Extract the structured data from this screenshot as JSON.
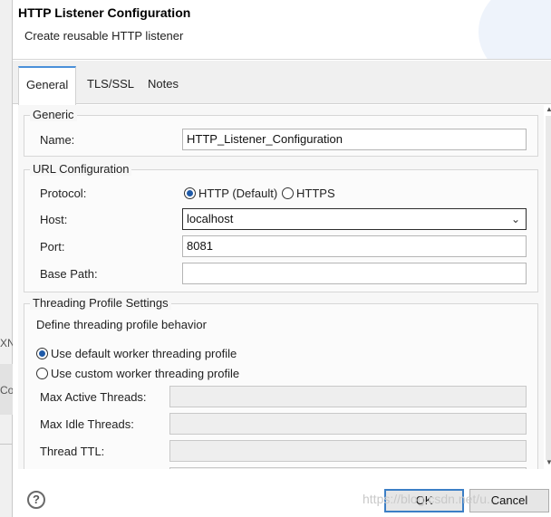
{
  "background": {
    "text_1": "XN",
    "text_2": "Co"
  },
  "dialog": {
    "title": "HTTP Listener Configuration",
    "subtitle": "Create reusable HTTP listener"
  },
  "tabs": [
    {
      "label": "General",
      "active": true
    },
    {
      "label": "TLS/SSL",
      "active": false
    },
    {
      "label": "Notes",
      "active": false
    }
  ],
  "generic": {
    "title": "Generic",
    "name_label": "Name:",
    "name_value": "HTTP_Listener_Configuration"
  },
  "url": {
    "title": "URL Configuration",
    "protocol_label": "Protocol:",
    "protocol_http": "HTTP (Default)",
    "protocol_https": "HTTPS",
    "protocol_selected": "HTTP (Default)",
    "host_label": "Host:",
    "host_value": "localhost",
    "port_label": "Port:",
    "port_value": "8081",
    "base_path_label": "Base Path:",
    "base_path_value": ""
  },
  "threading": {
    "title": "Threading Profile Settings",
    "description": "Define threading profile behavior",
    "option_default": "Use default worker threading profile",
    "option_custom": "Use custom worker threading profile",
    "selected": "Use default worker threading profile",
    "max_active_label": "Max Active Threads:",
    "max_idle_label": "Max Idle Threads:",
    "thread_ttl_label": "Thread TTL:"
  },
  "footer": {
    "help_glyph": "?",
    "ok_label": "OK",
    "cancel_label": "Cancel",
    "watermark": "https://blog.csdn.net/u..."
  },
  "colors": {
    "accent": "#3c7fc6",
    "radio_selected": "#1e5aa8"
  }
}
